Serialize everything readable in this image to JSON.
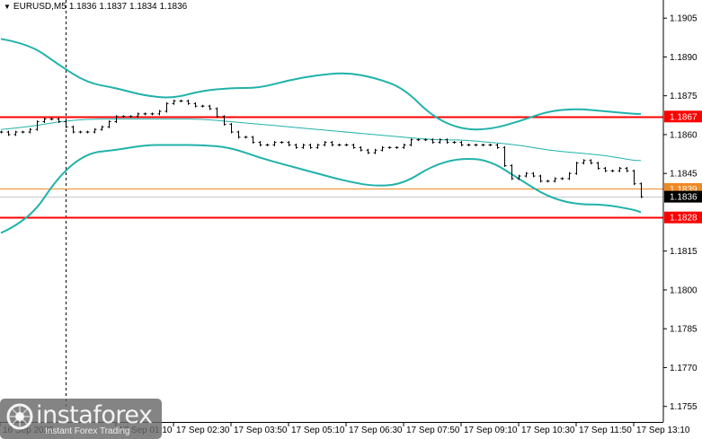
{
  "header": {
    "symbol": "EURUSD,M5",
    "open": "1.1836",
    "high": "1.1837",
    "low": "1.1834",
    "close": "1.1836"
  },
  "watermark": {
    "brand": "instaforex",
    "tagline": "Instant Forex Trading"
  },
  "colors": {
    "background": "#ffffff",
    "bars": "#000000",
    "bands": "#20b2aa",
    "level_red": "#ff0000",
    "level_orange": "#f08a24",
    "current_price_bg": "#000000",
    "axis": "#000000"
  },
  "chart_data": {
    "type": "line",
    "ylim": [
      1.1749,
      1.1912
    ],
    "grid": false,
    "y_ticks": [
      "1.1905",
      "1.1890",
      "1.1875",
      "1.1860",
      "1.1845",
      "1.1815",
      "1.1800",
      "1.1785",
      "1.1770",
      "1.1755"
    ],
    "x_ticks": [
      "16 Sep 2025",
      "17 Sep 01:10",
      "17 Sep 02:30",
      "17 Sep 03:50",
      "17 Sep 05:10",
      "17 Sep 06:30",
      "17 Sep 07:50",
      "17 Sep 09:10",
      "17 Sep 10:30",
      "17 Sep 11:50",
      "17 Sep 13:10"
    ],
    "period_separator": "17 Sep 00:00",
    "price": {
      "x": [
        "16 Sep 22:30",
        "16 Sep 22:40",
        "16 Sep 22:50",
        "16 Sep 23:00",
        "16 Sep 23:10",
        "16 Sep 23:20",
        "16 Sep 23:30",
        "16 Sep 23:40",
        "16 Sep 23:50",
        "17 Sep 00:00",
        "17 Sep 00:10",
        "17 Sep 00:20",
        "17 Sep 00:30",
        "17 Sep 00:40",
        "17 Sep 00:50",
        "17 Sep 01:00",
        "17 Sep 01:10",
        "17 Sep 01:20",
        "17 Sep 01:30",
        "17 Sep 01:40",
        "17 Sep 01:50",
        "17 Sep 02:00",
        "17 Sep 02:10",
        "17 Sep 02:20",
        "17 Sep 02:30",
        "17 Sep 02:40",
        "17 Sep 02:50",
        "17 Sep 03:00",
        "17 Sep 03:10",
        "17 Sep 03:20",
        "17 Sep 03:30",
        "17 Sep 03:40",
        "17 Sep 03:50",
        "17 Sep 04:00",
        "17 Sep 04:10",
        "17 Sep 04:20",
        "17 Sep 04:30",
        "17 Sep 04:40",
        "17 Sep 04:50",
        "17 Sep 05:00",
        "17 Sep 05:10",
        "17 Sep 05:20",
        "17 Sep 05:30",
        "17 Sep 05:40",
        "17 Sep 05:50",
        "17 Sep 06:00",
        "17 Sep 06:10",
        "17 Sep 06:20",
        "17 Sep 06:30",
        "17 Sep 06:40",
        "17 Sep 06:50",
        "17 Sep 07:00",
        "17 Sep 07:10",
        "17 Sep 07:20",
        "17 Sep 07:30",
        "17 Sep 07:40",
        "17 Sep 07:50",
        "17 Sep 08:00",
        "17 Sep 08:10",
        "17 Sep 08:20",
        "17 Sep 08:30",
        "17 Sep 08:40",
        "17 Sep 08:50",
        "17 Sep 09:00",
        "17 Sep 09:10",
        "17 Sep 09:20",
        "17 Sep 09:30",
        "17 Sep 09:40",
        "17 Sep 09:50",
        "17 Sep 10:00",
        "17 Sep 10:10",
        "17 Sep 10:20",
        "17 Sep 10:30",
        "17 Sep 10:40",
        "17 Sep 10:50",
        "17 Sep 11:00",
        "17 Sep 11:10",
        "17 Sep 11:20",
        "17 Sep 11:30",
        "17 Sep 11:40",
        "17 Sep 11:50",
        "17 Sep 12:00",
        "17 Sep 12:10",
        "17 Sep 12:20",
        "17 Sep 12:30",
        "17 Sep 12:40",
        "17 Sep 12:50",
        "17 Sep 13:00",
        "17 Sep 13:10",
        "17 Sep 13:20"
      ],
      "close": [
        1.1861,
        1.186,
        1.1861,
        1.1861,
        1.1862,
        1.1865,
        1.1866,
        1.1866,
        1.1865,
        1.1863,
        1.1861,
        1.1861,
        1.1861,
        1.1862,
        1.1863,
        1.1865,
        1.1867,
        1.1867,
        1.1867,
        1.1868,
        1.1868,
        1.1868,
        1.1869,
        1.1872,
        1.1873,
        1.1873,
        1.1872,
        1.1871,
        1.1871,
        1.187,
        1.1867,
        1.1864,
        1.1861,
        1.1859,
        1.1859,
        1.1857,
        1.1856,
        1.1856,
        1.1857,
        1.1857,
        1.1856,
        1.1855,
        1.1856,
        1.1855,
        1.1856,
        1.1857,
        1.1856,
        1.1856,
        1.1856,
        1.1855,
        1.1854,
        1.1853,
        1.1854,
        1.1855,
        1.1855,
        1.1855,
        1.1856,
        1.1858,
        1.1858,
        1.1858,
        1.1857,
        1.1858,
        1.1857,
        1.1857,
        1.1856,
        1.1856,
        1.1856,
        1.1856,
        1.1856,
        1.1855,
        1.1848,
        1.1843,
        1.1844,
        1.1845,
        1.1844,
        1.1842,
        1.1842,
        1.1843,
        1.1843,
        1.1845,
        1.1849,
        1.185,
        1.1849,
        1.1847,
        1.1846,
        1.1846,
        1.1847,
        1.1846,
        1.1841,
        1.1836
      ]
    },
    "bands": {
      "x": [
        "16 Sep 22:30",
        "16 Sep 23:10",
        "16 Sep 23:50",
        "17 Sep 00:30",
        "17 Sep 01:10",
        "17 Sep 01:50",
        "17 Sep 02:30",
        "17 Sep 03:10",
        "17 Sep 03:50",
        "17 Sep 04:30",
        "17 Sep 05:10",
        "17 Sep 05:50",
        "17 Sep 06:30",
        "17 Sep 07:10",
        "17 Sep 07:50",
        "17 Sep 08:30",
        "17 Sep 09:10",
        "17 Sep 09:50",
        "17 Sep 10:30",
        "17 Sep 11:10",
        "17 Sep 11:50",
        "17 Sep 12:30",
        "17 Sep 13:10",
        "17 Sep 13:20"
      ],
      "upper": [
        1.1897,
        1.1895,
        1.1887,
        1.188,
        1.1878,
        1.1875,
        1.1874,
        1.1877,
        1.1878,
        1.1878,
        1.1881,
        1.1883,
        1.1884,
        1.1882,
        1.1878,
        1.1867,
        1.1862,
        1.1862,
        1.1865,
        1.1869,
        1.187,
        1.1869,
        1.1868,
        1.1868
      ],
      "middle": [
        1.1862,
        1.1863,
        1.1865,
        1.1866,
        1.1866,
        1.1866,
        1.1866,
        1.1866,
        1.1865,
        1.1864,
        1.1863,
        1.1862,
        1.1861,
        1.186,
        1.1859,
        1.1858,
        1.1858,
        1.1857,
        1.1856,
        1.1854,
        1.1853,
        1.1852,
        1.185,
        1.185
      ],
      "lower": [
        1.1822,
        1.1827,
        1.1844,
        1.1853,
        1.1854,
        1.1856,
        1.1856,
        1.1856,
        1.1855,
        1.1851,
        1.1848,
        1.1845,
        1.1842,
        1.184,
        1.1841,
        1.1848,
        1.1851,
        1.185,
        1.1843,
        1.1836,
        1.1833,
        1.1833,
        1.1831,
        1.183
      ]
    },
    "levels": [
      {
        "value": "1.1867",
        "color": "#ff0000"
      },
      {
        "value": "1.1839",
        "color": "#f08a24"
      },
      {
        "value": "1.1828",
        "color": "#ff0000"
      }
    ],
    "current_price": "1.1836"
  }
}
